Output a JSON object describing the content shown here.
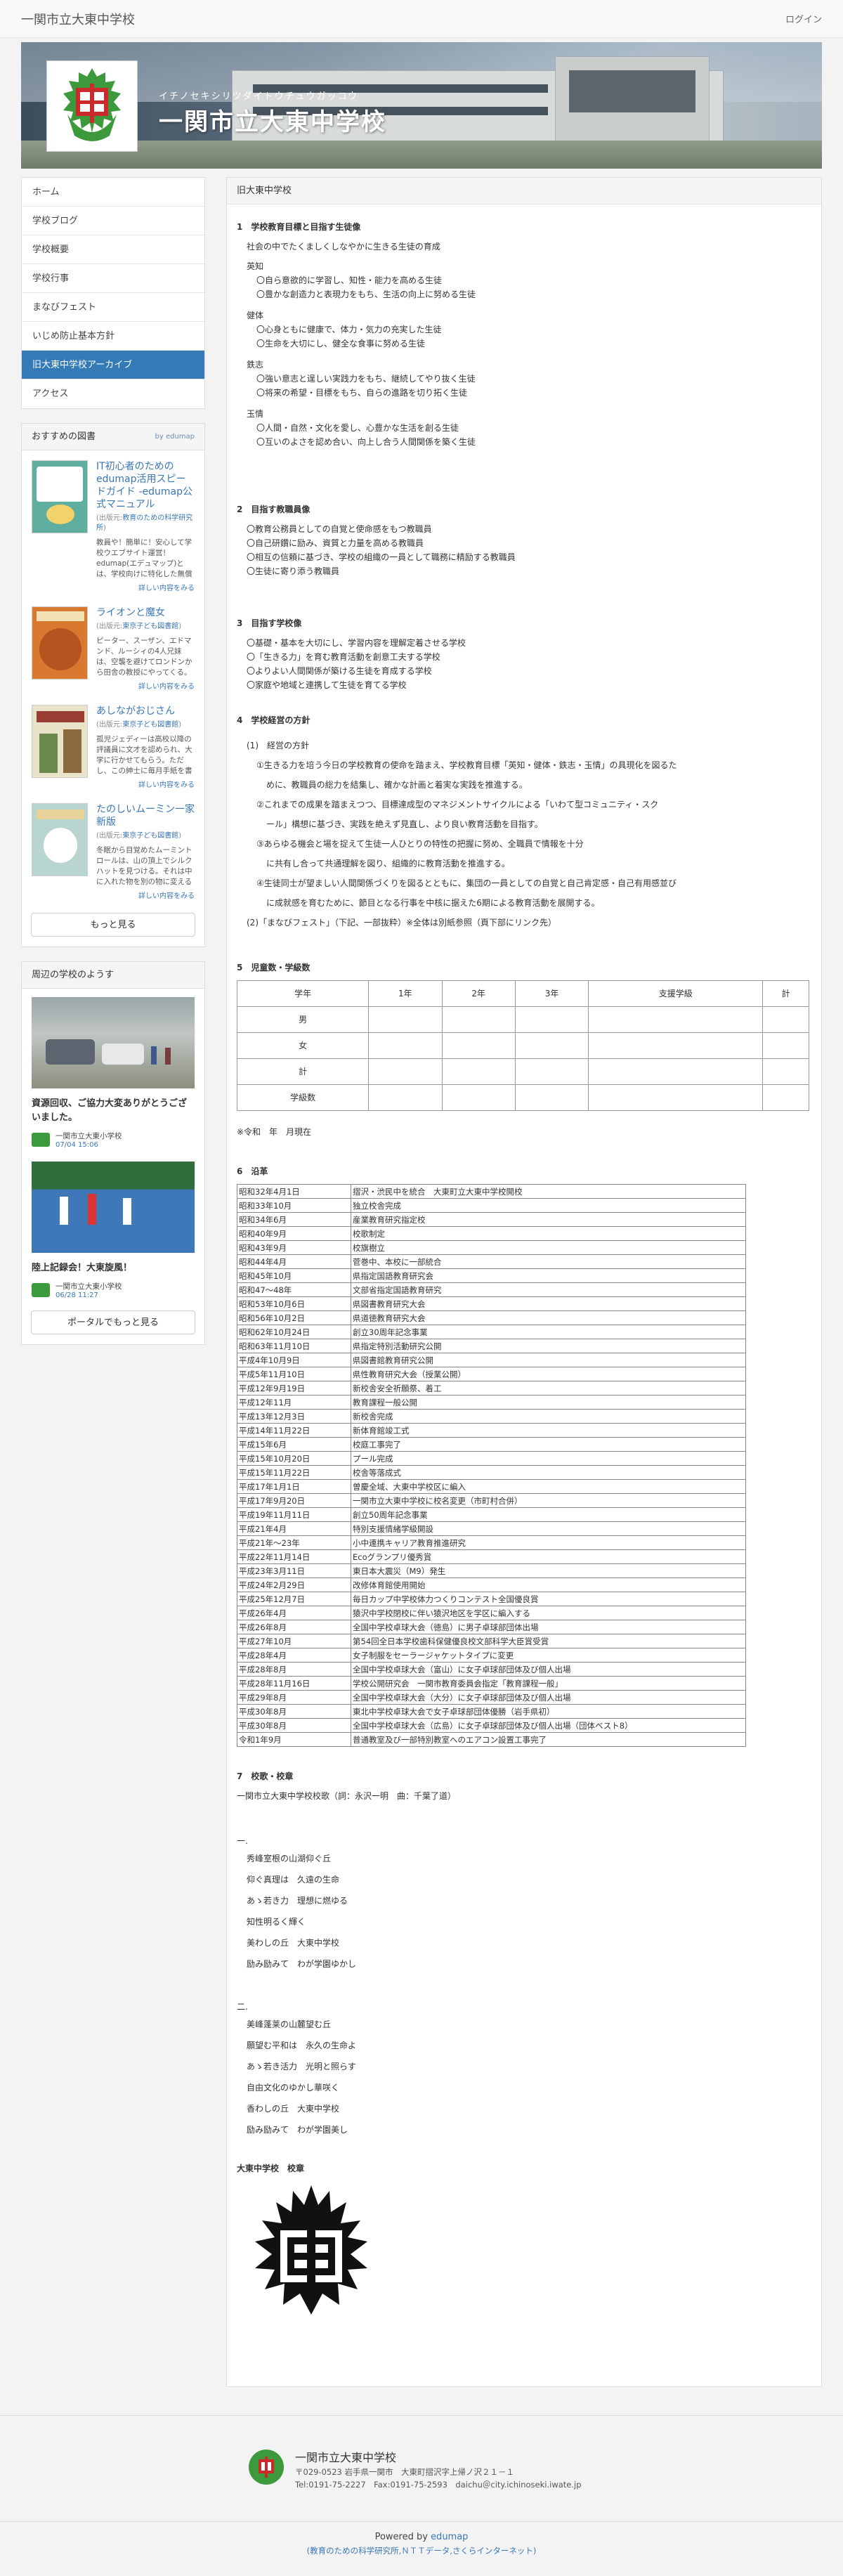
{
  "header": {
    "site_name": "一関市立大東中学校",
    "login": "ログイン"
  },
  "banner": {
    "kana": "イチノセキシリツダイトウチュウガッコウ",
    "title": "一関市立大東中学校"
  },
  "nav": [
    {
      "label": "ホーム"
    },
    {
      "label": "学校ブログ"
    },
    {
      "label": "学校概要"
    },
    {
      "label": "学校行事"
    },
    {
      "label": "まなびフェスト"
    },
    {
      "label": "いじめ防止基本方針"
    },
    {
      "label": "旧大東中学校アーカイブ"
    },
    {
      "label": "アクセス"
    }
  ],
  "books": {
    "title": "おすすめの図書",
    "by": "by edumap",
    "items": [
      {
        "title": "IT初心者のためのedumap活用スピードガイド -edumap公式マニュアル",
        "pub_pre": "(出版元:",
        "pub": "教育のための科学研究所",
        "pub_post": ")",
        "desc": "教員や！簡単に！安心して学校ウエブサイト運営！edumap(エデュマップ)とは、学校向けに特化した無償で利用できるホームページ",
        "more": "詳しい内容をみる"
      },
      {
        "title": "ライオンと魔女",
        "pub_pre": "(出版元:",
        "pub": "東京子ども図書館",
        "pub_post": ")",
        "desc": "ピーター、スーザン、エドマンド、ルーシィの4人兄妹は、空襲を避けてロンドンから田舎の教授にやってくる。その一室にあった衣装",
        "more": "詳しい内容をみる"
      },
      {
        "title": "あしながおじさん",
        "pub_pre": "(出版元:",
        "pub": "東京子ども図書館",
        "pub_post": ")",
        "desc": "孤児ジェディーは高校以降の評議員に文才を認められ、大学に行かせてもらう。ただし、この紳士に毎月手紙を書くという条件で。ジュ",
        "more": "詳しい内容をみる"
      },
      {
        "title": "たのしいムーミン一家 新版",
        "pub_pre": "(出版元:",
        "pub": "東京子ども図書館",
        "pub_post": ")",
        "desc": "冬眠から目覚めたムーミントロールは、山の頂上でシルクハットを見つける。それは中に入れた物を別の物に変える魔法の帽子だっ",
        "more": "詳しい内容をみる"
      }
    ],
    "more_button": "もっと見る"
  },
  "nearby": {
    "title": "周辺の学校のようす",
    "items": [
      {
        "title": "資源回収、ご協力大変ありがとうございました。",
        "school": "一関市立大東小学校",
        "date": "07/04 15:06"
      },
      {
        "title": "陸上記録会！大東旋風！",
        "school": "一関市立大東小学校",
        "date": "06/28 11:27"
      }
    ],
    "button": "ポータルでもっと見る"
  },
  "main": {
    "header": "旧大東中学校",
    "s1": {
      "title": "1　学校教育目標と目指す生徒像",
      "lead": "社会の中でたくましくしなやかに生きる生徒の育成",
      "groups": [
        {
          "name": "英知",
          "items": [
            "〇自ら意欲的に学習し、知性・能力を高める生徒",
            "〇豊かな創造力と表現力をもち、生活の向上に努める生徒"
          ]
        },
        {
          "name": "健体",
          "items": [
            "〇心身ともに健康で、体力・気力の充実した生徒",
            "〇生命を大切にし、健全な食事に努める生徒"
          ]
        },
        {
          "name": "鉄志",
          "items": [
            "〇強い意志と逞しい実践力をもち、継続してやり抜く生徒",
            "〇将来の希望・目標をもち、自らの進路を切り拓く生徒"
          ]
        },
        {
          "name": "玉情",
          "items": [
            "〇人間・自然・文化を愛し、心豊かな生活を創る生徒",
            "〇互いのよさを認め合い、向上し合う人間関係を築く生徒"
          ]
        }
      ]
    },
    "s2": {
      "title": "2　目指す教職員像",
      "items": [
        "〇教育公務員としての自覚と使命感をもつ教職員",
        "〇自己研鑽に励み、資質と力量を高める教職員",
        "〇相互の信頼に基づき、学校の組織の一員として職務に精励する教職員",
        "〇生徒に寄り添う教職員"
      ]
    },
    "s3": {
      "title": "3　目指す学校像",
      "items": [
        "〇基礎・基本を大切にし、学習内容を理解定着させる学校",
        "〇「生きる力」を育む教育活動を創意工夫する学校",
        "〇よりよい人間関係が築ける生徒を育成する学校",
        "〇家庭や地域と連携して生徒を育てる学校"
      ]
    },
    "s4": {
      "title": "4　学校経営の方針",
      "sub1": "(1)　経営の方針",
      "p1a": "①生きる力を培う今日の学校教育の使命を踏まえ、学校教育目標「英知・健体・鉄志・玉情」の具現化を図るた",
      "p1b": "めに、教職員の総力を結集し、確かな計画と着実な実践を推進する。",
      "p2a": "②これまでの成果を踏まえつつ、目標達成型のマネジメントサイクルによる「いわて型コミュニティ・スク",
      "p2b": "ール」構想に基づき、実践を絶えず見直し、より良い教育活動を目指す。",
      "p3a": "③あらゆる機会と場を捉えて生徒一人ひとりの特性の把握に努め、全職員で情報を十分",
      "p3b": "に共有し合って共通理解を図り、組織的に教育活動を推進する。",
      "p4a": "④生徒同士が望ましい人間関係づくりを図るとともに、集団の一員としての自覚と自己肯定感・自己有用感並び",
      "p4b": "に成就感を育むために、節目となる行事を中核に据えた6期による教育活動を展開する。",
      "sub2": "(2)「まなびフェスト」（下記、一部抜粋）※全体は別紙参照（頁下部にリンク先）"
    },
    "s5": {
      "title": "5　児童数・学級数",
      "headers": [
        "学年",
        "1年",
        "2年",
        "3年",
        "支援学級",
        "計"
      ],
      "rows": [
        [
          "男",
          "",
          "",
          "",
          "",
          ""
        ],
        [
          "女",
          "",
          "",
          "",
          "",
          ""
        ],
        [
          "計",
          "",
          "",
          "",
          "",
          ""
        ],
        [
          "学級数",
          "",
          "",
          "",
          "",
          ""
        ]
      ],
      "note": "※令和　年　月現在"
    },
    "s6": {
      "title": "6　沿革",
      "rows": [
        [
          "昭和32年4月1日",
          "摺沢・渋民中を統合　大東町立大東中学校開校"
        ],
        [
          "昭和33年10月",
          "独立校舎完成"
        ],
        [
          "昭和34年6月",
          "産業教育研究指定校"
        ],
        [
          "昭和40年9月",
          "校歌制定"
        ],
        [
          "昭和43年9月",
          "校旗樹立"
        ],
        [
          "昭和44年4月",
          "菅巻中、本校に一部統合"
        ],
        [
          "昭和45年10月",
          "県指定国語教育研究会"
        ],
        [
          "昭和47〜48年",
          "文部省指定国語教育研究"
        ],
        [
          "昭和53年10月6日",
          "県図書教育研究大会"
        ],
        [
          "昭和56年10月2日",
          "県道徳教育研究大会"
        ],
        [
          "昭和62年10月24日",
          "創立30周年記念事業"
        ],
        [
          "昭和63年11月10日",
          "県指定特別活動研究公開"
        ],
        [
          "平成4年10月9日",
          "県図書館教育研究公開"
        ],
        [
          "平成5年11月10日",
          "県性教育研究大会（授業公開）"
        ],
        [
          "平成12年9月19日",
          "新校舎安全祈願祭、着工"
        ],
        [
          "平成12年11月",
          "教育課程一般公開"
        ],
        [
          "平成13年12月3日",
          "新校舎完成"
        ],
        [
          "平成14年11月22日",
          "新体育館竣工式"
        ],
        [
          "平成15年6月",
          "校庭工事完了"
        ],
        [
          "平成15年10月20日",
          "プール完成"
        ],
        [
          "平成15年11月22日",
          "校舎等落成式"
        ],
        [
          "平成17年1月1日",
          "曽慶全域、大東中学校区に編入"
        ],
        [
          "平成17年9月20日",
          "一関市立大東中学校に校名変更（市町村合併）"
        ],
        [
          "平成19年11月11日",
          "創立50周年記念事業"
        ],
        [
          "平成21年4月",
          "特別支援情緒学級開設"
        ],
        [
          "平成21年〜23年",
          "小中連携キャリア教育推進研究"
        ],
        [
          "平成22年11月14日",
          "Ecoグランプリ優秀賞"
        ],
        [
          "平成23年3月11日",
          "東日本大震災（M9）発生"
        ],
        [
          "平成24年2月29日",
          "改修体育館使用開始"
        ],
        [
          "平成25年12月7日",
          "毎日カップ中学校体力つくりコンテスト全国優良賞"
        ],
        [
          "平成26年4月",
          "猿沢中学校閉校に伴い猿沢地区を学区に編入する"
        ],
        [
          "平成26年8月",
          "全国中学校卓球大会（徳島）に男子卓球部団体出場"
        ],
        [
          "平成27年10月",
          "第54回全日本学校歯科保健優良校文部科学大臣賞受賞"
        ],
        [
          "平成28年4月",
          "女子制服をセーラージャケットタイプに変更"
        ],
        [
          "平成28年8月",
          "全国中学校卓球大会（富山）に女子卓球部団体及び個人出場"
        ],
        [
          "平成28年11月16日",
          "学校公開研究会　一関市教育委員会指定「教育課程一般」"
        ],
        [
          "平成29年8月",
          "全国中学校卓球大会（大分）に女子卓球部団体及び個人出場"
        ],
        [
          "平成30年8月",
          "東北中学校卓球大会で女子卓球部団体優勝（岩手県初）"
        ],
        [
          "平成30年8月",
          "全国中学校卓球大会（広島）に女子卓球部団体及び個人出場（団体ベスト8）"
        ],
        [
          "令和1年9月",
          "普通教室及び一部特別教室へのエアコン設置工事完了"
        ]
      ]
    },
    "s7": {
      "title": "7　校歌・校章",
      "credit": "一関市立大東中学校校歌（詞：永沢一明　曲：千葉了道）",
      "v1_label": "一.",
      "v1": [
        "秀峰室根の山湖仰ぐ丘",
        "仰ぐ真理は　久遠の生命",
        "あゝ若き力　理想に燃ゆる",
        "知性明るく輝く",
        "美わしの丘　大東中学校",
        "励み励みて　わが学園ゆかし"
      ],
      "v2_label": "二.",
      "v2": [
        "美峰蓬莱の山麓望む丘",
        "願望む平和は　永久の生命よ",
        "あゝ若き活力　光明と照らす",
        "自由文化のゆかし華咲く",
        "香わしの丘　大東中学校",
        "励み励みて　わが学園美し"
      ],
      "emblem_title": "大東中学校　校章"
    }
  },
  "footer": {
    "name": "一関市立大東中学校",
    "address": "〒029-0523 岩手県一関市　大東町摺沢字上帰ノ沢２１－１",
    "contact": "Tel:0191-75-2227　Fax:0191-75-2593　daichu＠city.ichinoseki.iwate.jp",
    "powered_pre": "Powered by",
    "powered": "edumap",
    "sub": "(教育のための科学研究所,ＮＴＴデータ,さくらインターネット)"
  },
  "colors": {
    "active_nav": "#337ab7",
    "link": "#3a77b4",
    "emblem_green": "#3c9a3c",
    "emblem_red": "#cc2a2a"
  }
}
